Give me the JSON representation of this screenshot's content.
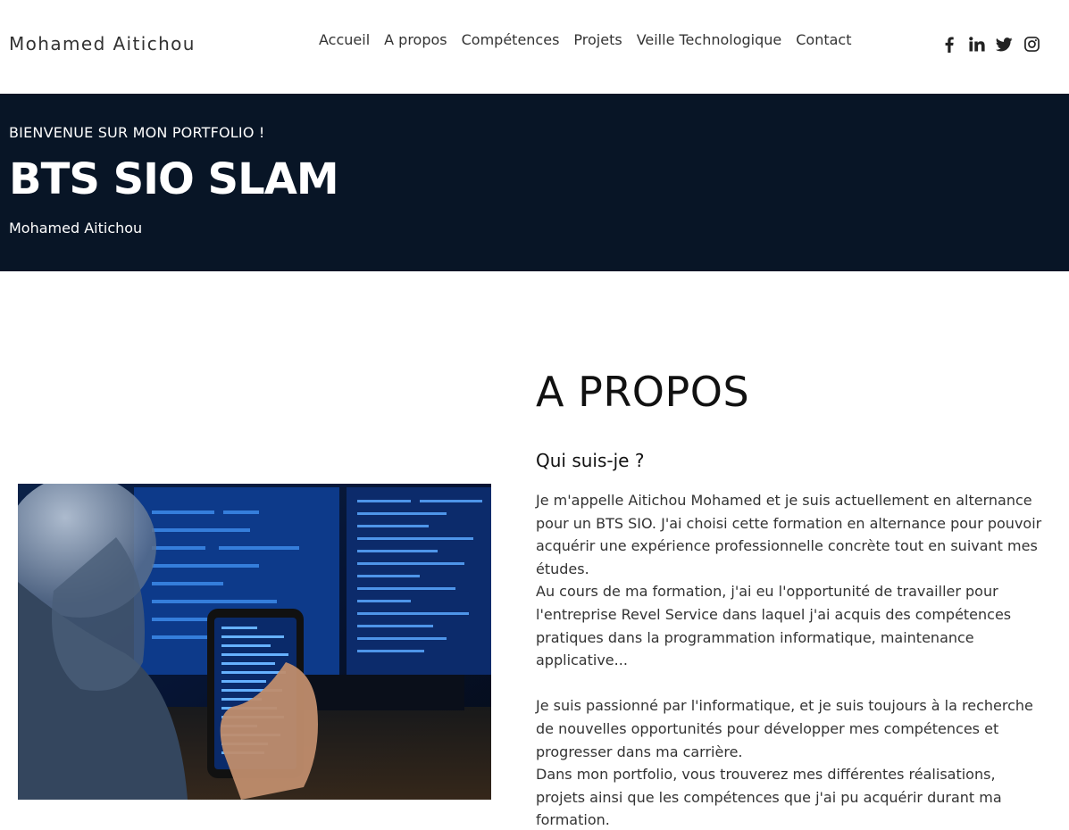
{
  "header": {
    "brand": "Mohamed Aitichou",
    "nav": [
      "Accueil",
      "A propos",
      "Compétences",
      "Projets",
      "Veille Technologique",
      "Contact"
    ],
    "social_icons": [
      "facebook-icon",
      "linkedin-icon",
      "twitter-icon",
      "instagram-icon"
    ]
  },
  "hero": {
    "kicker": "BIENVENUE SUR MON PORTFOLIO !",
    "title": "BTS SIO SLAM",
    "subtitle": "Mohamed Aitichou",
    "background": "#081526"
  },
  "about": {
    "title": "A PROPOS",
    "subtitle": "Qui suis-je ?",
    "paragraph1": "Je m'appelle Aitichou Mohamed et je suis actuellement en alternance pour un BTS SIO. J'ai choisi cette formation en alternance pour pouvoir acquérir une expérience professionnelle concrète tout en suivant mes études.",
    "paragraph2": "Au cours de ma formation, j'ai eu l'opportunité de travailler pour l'entreprise Revel Service dans laquel j'ai acquis des compétences pratiques dans la programmation informatique, maintenance applicative...",
    "paragraph3": "Je suis passionné par l'informatique, et je suis toujours à la recherche de nouvelles opportunités pour développer mes compétences et progresser dans ma carrière.",
    "paragraph4": "Dans mon portfolio, vous trouverez mes différentes réalisations, projets ainsi que les compétences que j'ai pu acquérir durant ma formation.",
    "image": "developer-with-phone-photo"
  }
}
